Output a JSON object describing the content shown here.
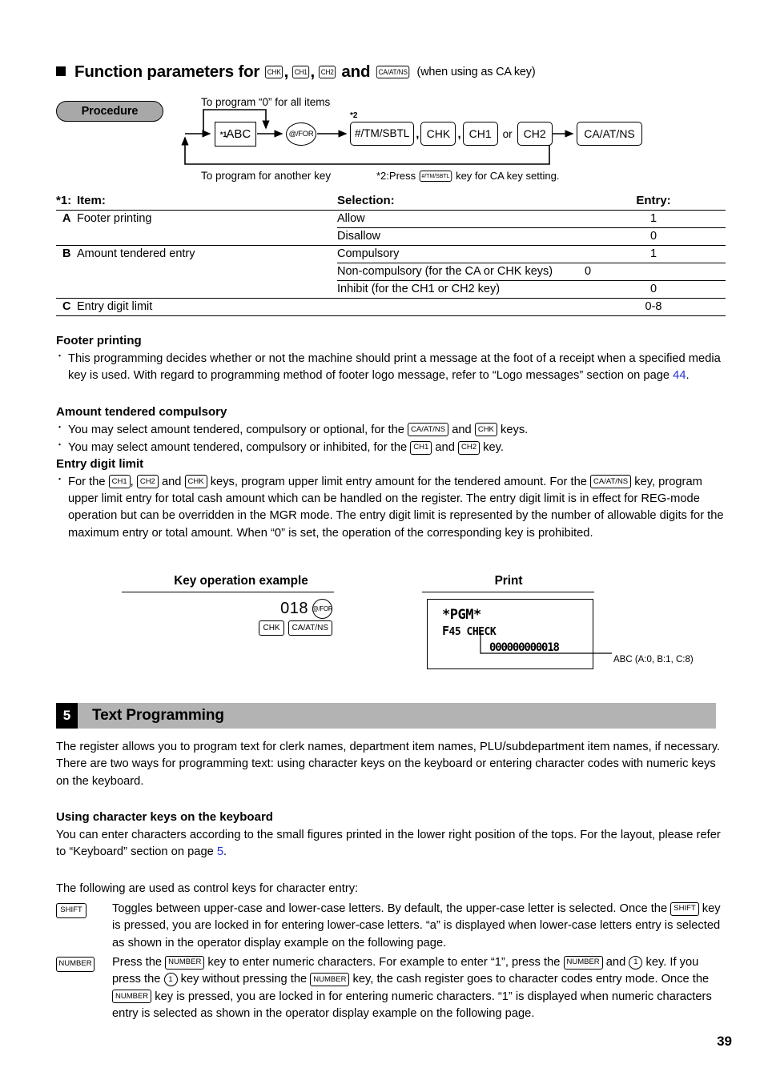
{
  "page": {
    "number": "39"
  },
  "section_heading": {
    "prefix": "Function parameters for",
    "keys": [
      "CHK",
      "CH1",
      "CH2"
    ],
    "conjunction": "and",
    "last_key": "CA/AT/NS",
    "note": "(when using as CA key)"
  },
  "procedure": {
    "badge": "Procedure",
    "top_label": "To program  “0” for all items",
    "bottom_label": "To program for another key",
    "star2_marker": "*2",
    "footnote_prefix": "*2:Press",
    "footnote_key": "#/TM/SBTL",
    "footnote_suffix": "key for CA key setting.",
    "node_abc_sup": "*1",
    "node_abc": "ABC",
    "node_for": "@/FOR",
    "keygroup": {
      "key1": "#/TM/SBTL",
      "sep1": ",",
      "key2": "CHK",
      "sep2": ",",
      "key3": "CH1",
      "or": "or",
      "key4": "CH2"
    },
    "node_ca": "CA/AT/NS"
  },
  "table": {
    "star1": "*1:",
    "headers": {
      "item": "Item:",
      "selection": "Selection:",
      "entry": "Entry:"
    },
    "rows": [
      {
        "letter": "A",
        "item": "Footer printing",
        "selection": "Allow",
        "entry": "1"
      },
      {
        "letter": "",
        "item": "",
        "selection": "Disallow",
        "entry": "0"
      },
      {
        "letter": "B",
        "item": "Amount tendered entry",
        "selection": "Compulsory",
        "entry": "1"
      },
      {
        "letter": "",
        "item": "",
        "selection": "Non-compulsory (for the CA or CHK keys)",
        "entry": "0"
      },
      {
        "letter": "",
        "item": "",
        "selection": "Inhibit (for the CH1 or CH2 key)",
        "entry": "0"
      },
      {
        "letter": "C",
        "item": "Entry digit limit",
        "selection": "",
        "entry": "0-8"
      }
    ]
  },
  "footer_printing": {
    "heading": "Footer printing",
    "bullet1_a": "This programming decides whether or not the machine should print a message at the foot of a receipt when a specified media key is used.  With regard to programming method of footer logo message, refer to “Logo messages” section on page ",
    "bullet1_page": "44",
    "bullet1_b": "."
  },
  "amount_tendered": {
    "heading": "Amount tendered compulsory",
    "b1_p1": "You may select amount tendered, compulsory or optional, for the",
    "b1_key1": "CA/AT/NS",
    "b1_p2": "and",
    "b1_key2": "CHK",
    "b1_p3": "keys.",
    "b2_p1": "You may select amount tendered, compulsory or inhibited, for the",
    "b2_key1": "CH1",
    "b2_p2": "and",
    "b2_key2": "CH2",
    "b2_p3": "key."
  },
  "entry_digit_limit": {
    "heading": "Entry digit limit",
    "p1": "For the",
    "key1": "CH1",
    "c1": ",",
    "key2": "CH2",
    "p2": "and",
    "key3": "CHK",
    "p3": "keys, program upper limit entry amount for the tendered amount.  For the",
    "key4": "CA/AT/NS",
    "p4": "key, program upper limit entry for total cash amount which can be handled on the register.  The entry digit limit is in effect for REG-mode operation but can be overridden in the MGR mode.  The entry digit limit is represented by the number of allowable digits for the maximum entry or total amount.  When “0” is set, the operation of the corresponding key is prohibited."
  },
  "example": {
    "key_operation_title": "Key operation example",
    "print_title": "Print",
    "keys_number": "018",
    "key_for": "@/FOR",
    "key_chk": "CHK",
    "key_ca": "CA/AT/NS",
    "print_line1": "*PGM*",
    "print_line2_bold": "F",
    "print_line2_rest": "45 CHECK",
    "print_line3": "000000000018",
    "abc_note": "ABC (A:0, B:1, C:8)"
  },
  "section5": {
    "number": "5",
    "title": "Text Programming",
    "intro": "The register allows you to program text for clerk names, department item names, PLU/subdepartment item names, if necessary.  There are two ways for programming text:  using character keys on the keyboard or entering character codes with numeric keys on the keyboard."
  },
  "using_char_keys": {
    "heading": "Using character keys on the keyboard",
    "p1": "You can enter characters according to the small figures printed in the lower right position of the tops.  For the layout, please refer to “Keyboard” section on page ",
    "p1_page": "5",
    "p1_end": ".",
    "p2": "The following are used as control keys for character entry:"
  },
  "control_keys": {
    "shift": {
      "key": "SHIFT",
      "t1": "Toggles between upper-case and lower-case letters.  By default, the upper-case letter is selected. Once the",
      "key_inline": "SHIFT",
      "t2": "key is pressed, you are locked in for entering lower-case letters.  “a” is displayed when lower-case letters entry is selected as shown in the operator display example on the following page."
    },
    "number": {
      "key": "NUMBER",
      "t1": "Press the",
      "k1": "NUMBER",
      "t2": "key to enter numeric characters.  For example to enter “1”, press the",
      "k2": "NUMBER",
      "t3": "and",
      "k3": "1",
      "t4": "key.  If you press the",
      "k4": "1",
      "t5": "key without pressing the",
      "k5": "NUMBER",
      "t6": "key, the cash register goes to character codes entry mode.  Once the",
      "k6": "NUMBER",
      "t7": "key is pressed, you are locked in for entering numeric characters.  “1” is displayed when numeric characters entry is selected as shown in the operator display example on the following page."
    }
  },
  "colors": {
    "link": "#2432d8",
    "badge_gray": "#a8a8a8",
    "section_gray": "#b3b3b3"
  }
}
